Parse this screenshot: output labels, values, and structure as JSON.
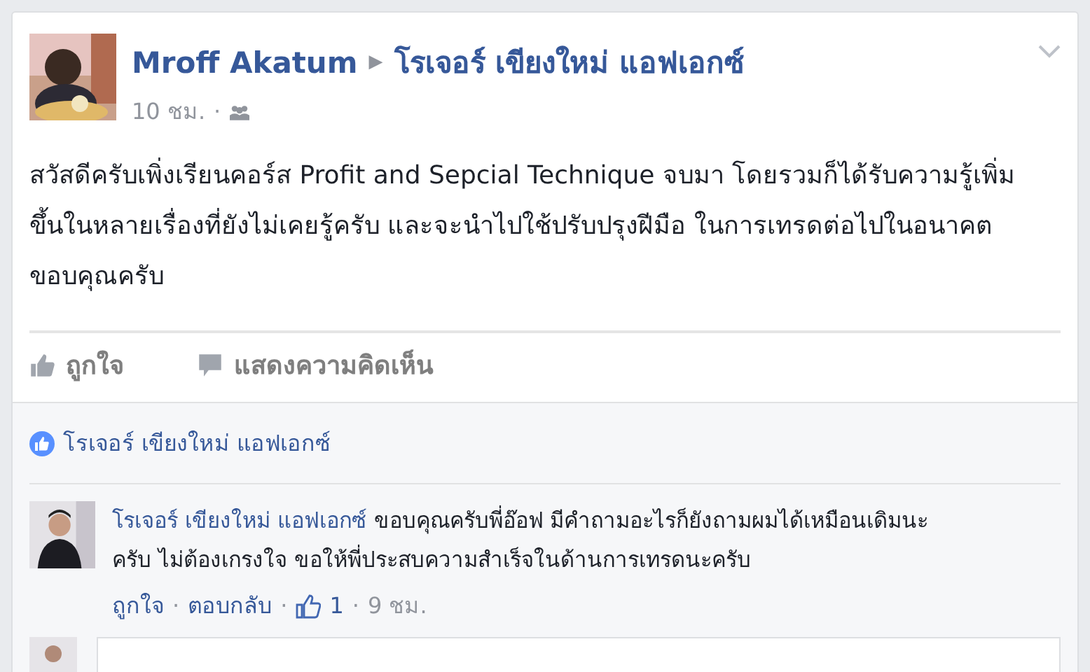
{
  "post": {
    "author": "Mroff Akatum",
    "separator": "▶",
    "target": "โรเจอร์ เขียงใหม่ แอฟเอกซ์",
    "time": "10 ชม.",
    "dot": "·",
    "body": "สวัสดีครับเพิ่งเรียนคอร์ส Profit and Sepcial Technique จบมา โดยรวมก็ได้รับความรู้เพิ่มขึ้นในหลายเรื่องที่ยังไม่เคยรู้ครับ และจะนำไปใช้ปรับปรุงฝีมือ ในการเทรดต่อไปในอนาคต ขอบคุณครับ",
    "actions": [
      {
        "kind": "like",
        "label": "ถูกใจ"
      },
      {
        "kind": "comment",
        "label": "แสดงความคิดเห็น"
      }
    ]
  },
  "likes": {
    "names": "โรเจอร์ เขียงใหม่ แอฟเอกซ์"
  },
  "comments": [
    {
      "author": "โรเจอร์ เขียงใหม่ แอฟเอกซ์",
      "text": "ขอบคุณครับพี่อ๊อฟ มีคำถามอะไรก็ยังถามผมได้เหมือนเดิมนะครับ ไม่ต้องเกรงใจ ขอให้พี่ประสบความสำเร็จในด้านการเทรดนะครับ",
      "like": "ถูกใจ",
      "reply": "ตอบกลับ",
      "like_count": "1",
      "time": "9 ชม.",
      "dot": "·"
    }
  ]
}
